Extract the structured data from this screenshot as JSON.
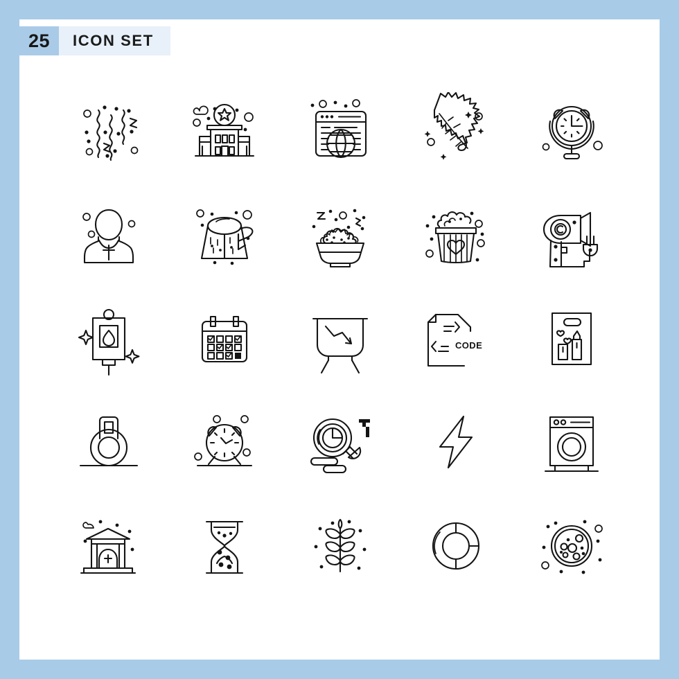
{
  "page": {
    "background_color": "#a8cbe8",
    "card_color": "#ffffff"
  },
  "header": {
    "count": "25",
    "title": "ICON SET",
    "count_bg": "#a9cbe7",
    "title_bg": "#e8f1f9",
    "text_color": "#171717"
  },
  "grid": {
    "columns": 5,
    "rows": 5,
    "total_icons": 25,
    "stroke_color": "#141414",
    "icons": [
      {
        "name": "confetti-streamers-icon",
        "label": "Confetti"
      },
      {
        "name": "police-station-icon",
        "label": "Police Station"
      },
      {
        "name": "web-browser-globe-icon",
        "label": "Website"
      },
      {
        "name": "leaf-icon",
        "label": "Leaf"
      },
      {
        "name": "alarm-clock-stand-icon",
        "label": "Alarm Clock"
      },
      {
        "name": "priest-icon",
        "label": "Priest"
      },
      {
        "name": "tree-stump-icon",
        "label": "Tree Stump"
      },
      {
        "name": "popcorn-bowl-icon",
        "label": "Popcorn Bowl"
      },
      {
        "name": "popcorn-bucket-heart-icon",
        "label": "Popcorn Bucket"
      },
      {
        "name": "hair-dryer-icon",
        "label": "Hair Dryer"
      },
      {
        "name": "blood-bag-icon",
        "label": "Blood Bag"
      },
      {
        "name": "calendar-icon",
        "label": "Calendar"
      },
      {
        "name": "presentation-decline-chart-icon",
        "label": "Loss Chart"
      },
      {
        "name": "code-file-icon",
        "label": "Code File",
        "text": "CODE"
      },
      {
        "name": "cosmetics-bag-icon",
        "label": "Cosmetics Bag"
      },
      {
        "name": "kettlebell-icon",
        "label": "Kettlebell"
      },
      {
        "name": "alarm-clock-legs-icon",
        "label": "Alarm Clock"
      },
      {
        "name": "data-analysis-magnifier-icon",
        "label": "Data Analysis"
      },
      {
        "name": "lightning-bolt-icon",
        "label": "Lightning"
      },
      {
        "name": "washing-machine-icon",
        "label": "Washing Machine"
      },
      {
        "name": "bank-building-icon",
        "label": "Bank"
      },
      {
        "name": "hourglass-icon",
        "label": "Hourglass"
      },
      {
        "name": "plant-sprout-icon",
        "label": "Plant"
      },
      {
        "name": "donut-chart-icon",
        "label": "Donut Chart"
      },
      {
        "name": "petri-dish-icon",
        "label": "Petri Dish"
      }
    ]
  }
}
